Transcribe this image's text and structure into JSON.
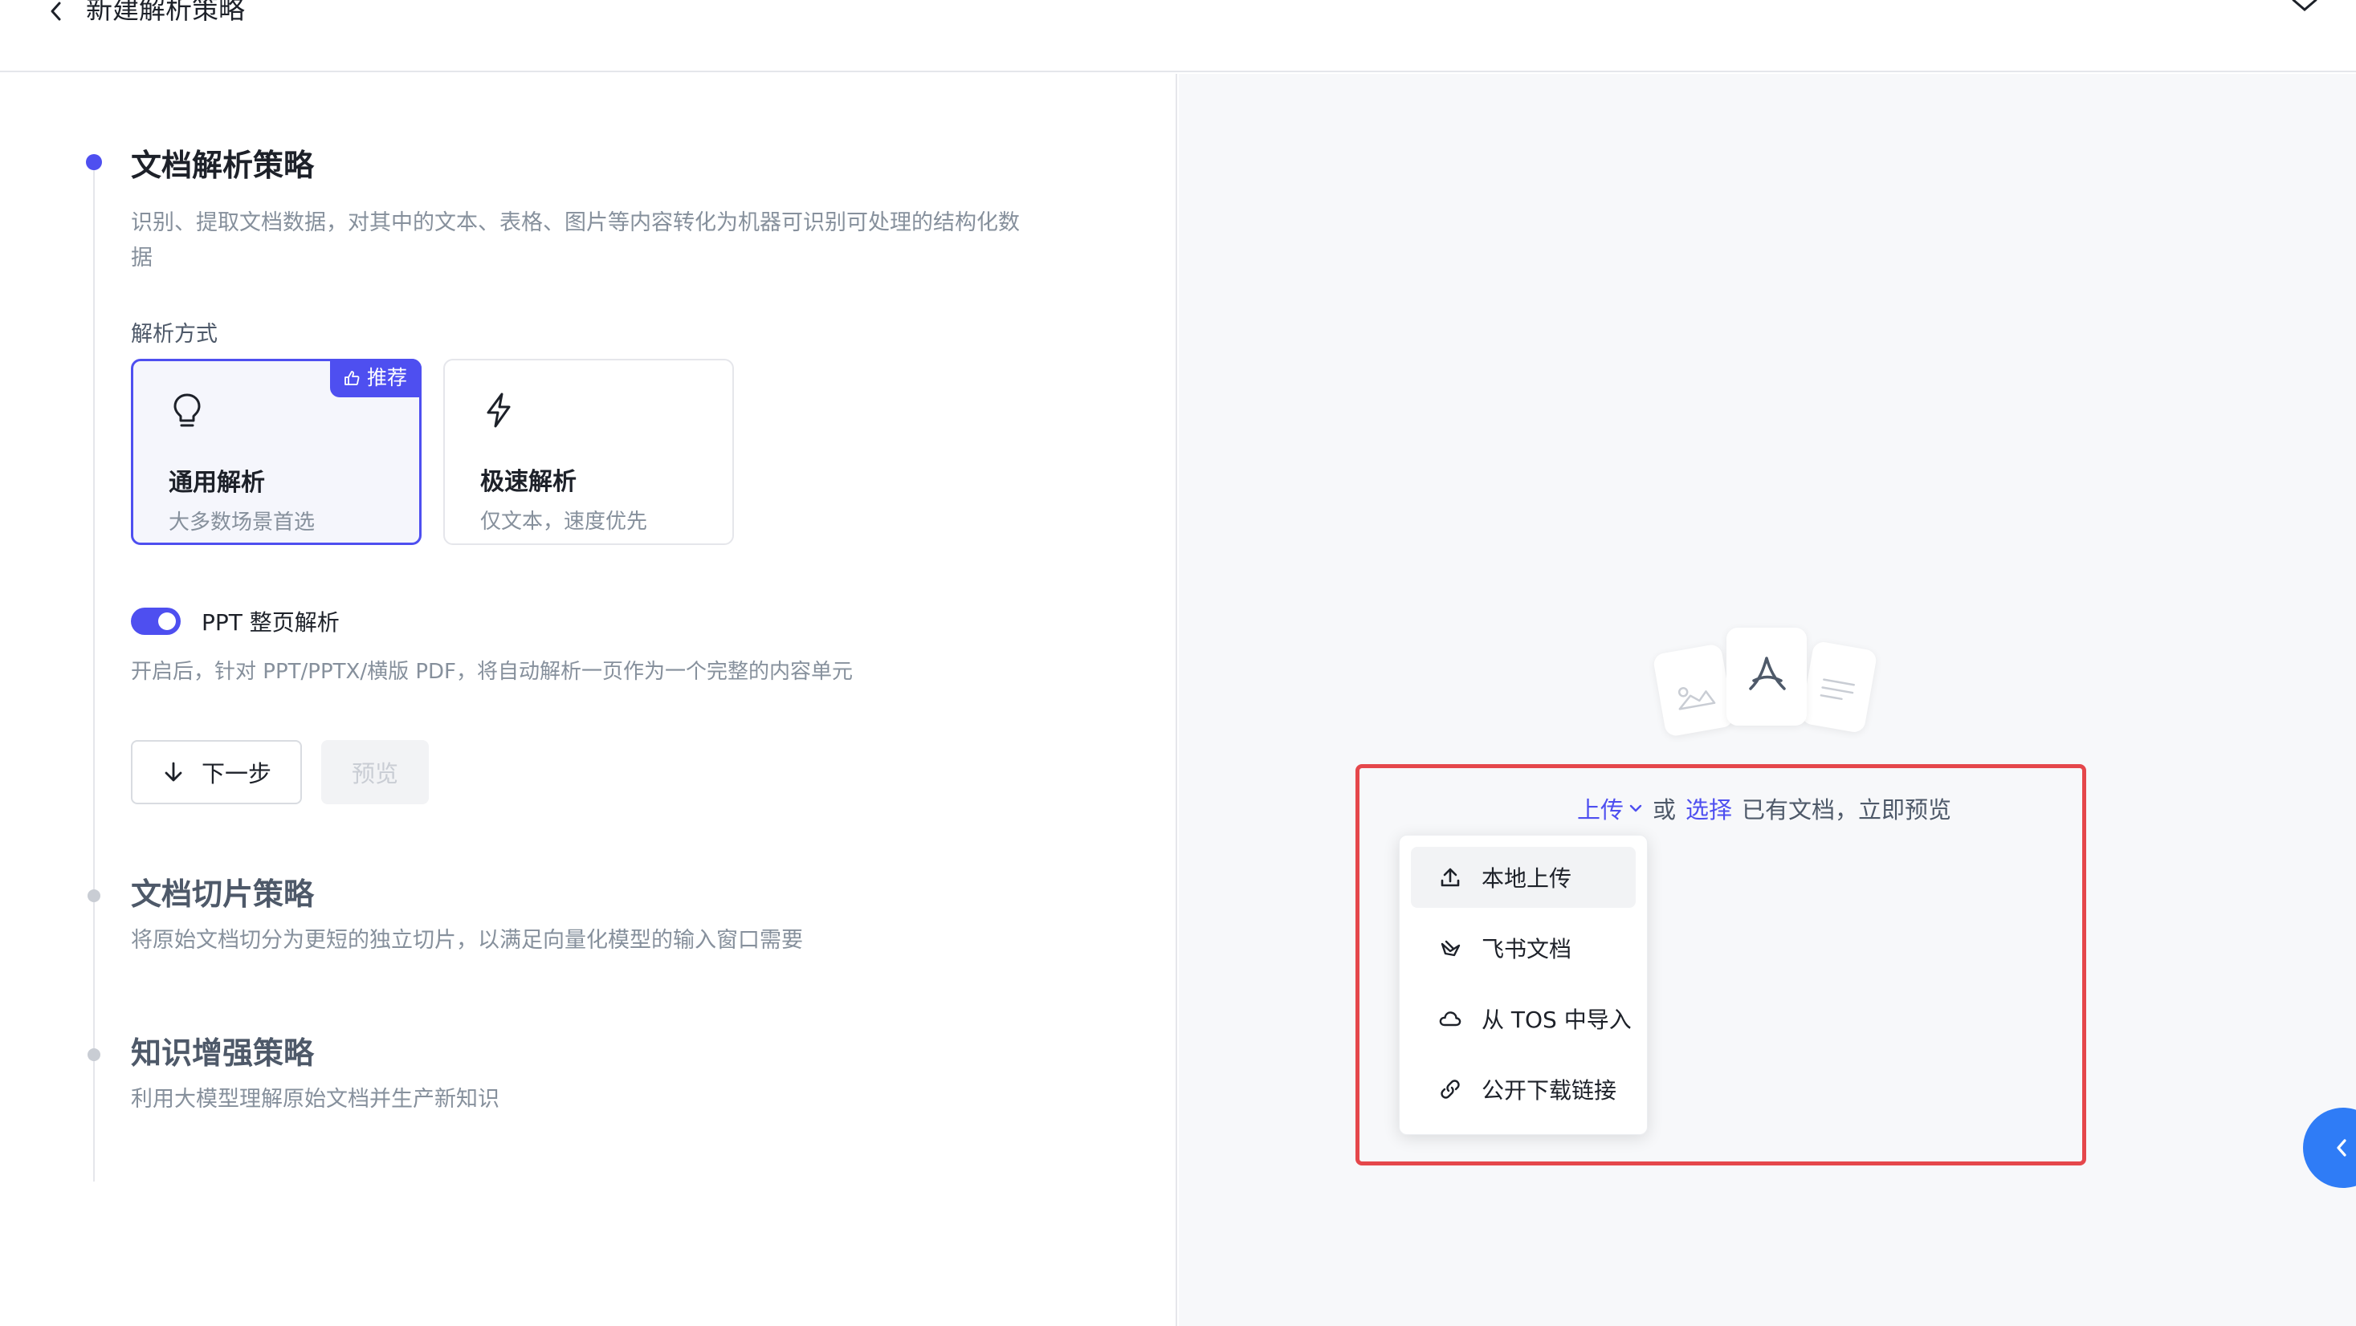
{
  "header": {
    "title": "新建解析策略"
  },
  "steps": [
    {
      "title": "文档解析策略",
      "description": "识别、提取文档数据，对其中的文本、表格、图片等内容转化为机器可识别可处理的结构化数",
      "description_cont": "据",
      "state": "active"
    },
    {
      "title": "文档切片策略",
      "description": "将原始文档切分为更短的独立切片，以满足向量化模型的输入窗口需要",
      "state": "idle"
    },
    {
      "title": "知识增强策略",
      "description": "利用大模型理解原始文档并生产新知识",
      "state": "idle"
    }
  ],
  "parse_mode": {
    "label": "解析方式",
    "options": [
      {
        "title": "通用解析",
        "subtitle": "大多数场景首选",
        "icon": "lightbulb-icon",
        "badge": "推荐",
        "selected": true
      },
      {
        "title": "极速解析",
        "subtitle": "仅文本，速度优先",
        "icon": "lightning-icon",
        "selected": false
      }
    ]
  },
  "ppt_toggle": {
    "label": "PPT 整页解析",
    "enabled": true,
    "description": "开启后，针对 PPT/PPTX/横版 PDF，将自动解析一页作为一个完整的内容单元"
  },
  "actions": {
    "next": "下一步",
    "preview": "预览"
  },
  "preview_panel": {
    "upload_link": "上传",
    "or_text": "或",
    "select_link": "选择",
    "rest_text": "已有文档，立即预览",
    "menu": [
      {
        "label": "本地上传",
        "icon": "upload-icon"
      },
      {
        "label": "飞书文档",
        "icon": "feishu-icon"
      },
      {
        "label": "从 TOS 中导入",
        "icon": "cloud-icon"
      },
      {
        "label": "公开下载链接",
        "icon": "link-icon"
      }
    ]
  },
  "colors": {
    "accent": "#4e4ff0",
    "highlight": "#e5474b",
    "side_button": "#2f7cf6"
  }
}
